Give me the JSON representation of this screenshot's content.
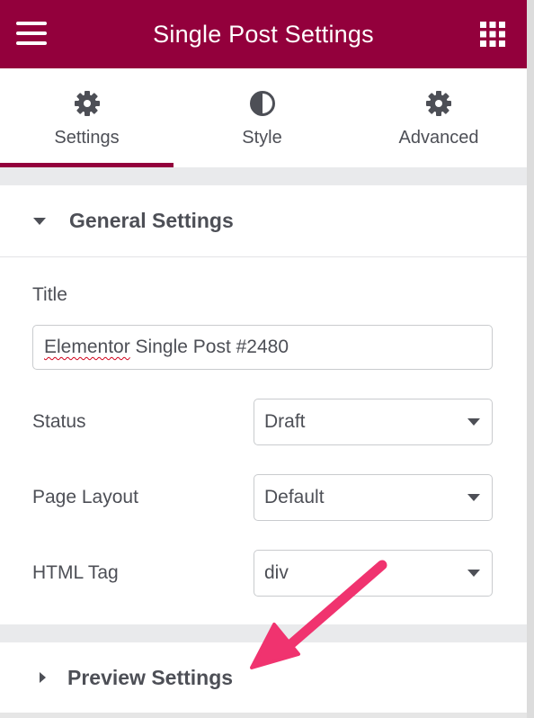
{
  "header": {
    "title": "Single Post Settings",
    "menu_icon": "hamburger-icon",
    "grid_icon": "grid-icon",
    "bg_color": "#93003c"
  },
  "tabs": [
    {
      "label": "Settings",
      "icon": "gear-icon",
      "active": true
    },
    {
      "label": "Style",
      "icon": "half-circle-icon",
      "active": false
    },
    {
      "label": "Advanced",
      "icon": "gear-icon",
      "active": false
    }
  ],
  "general": {
    "title": "General Settings",
    "title_field": {
      "label": "Title",
      "value": "Elementor Single Post #2480",
      "misspelled_word": "Elementor",
      "rest": " Single Post #2480"
    },
    "status": {
      "label": "Status",
      "value": "Draft"
    },
    "page_layout": {
      "label": "Page Layout",
      "value": "Default"
    },
    "html_tag": {
      "label": "HTML Tag",
      "value": "div"
    }
  },
  "preview": {
    "title": "Preview Settings"
  },
  "annotation": {
    "arrow_color": "#f0336f"
  }
}
